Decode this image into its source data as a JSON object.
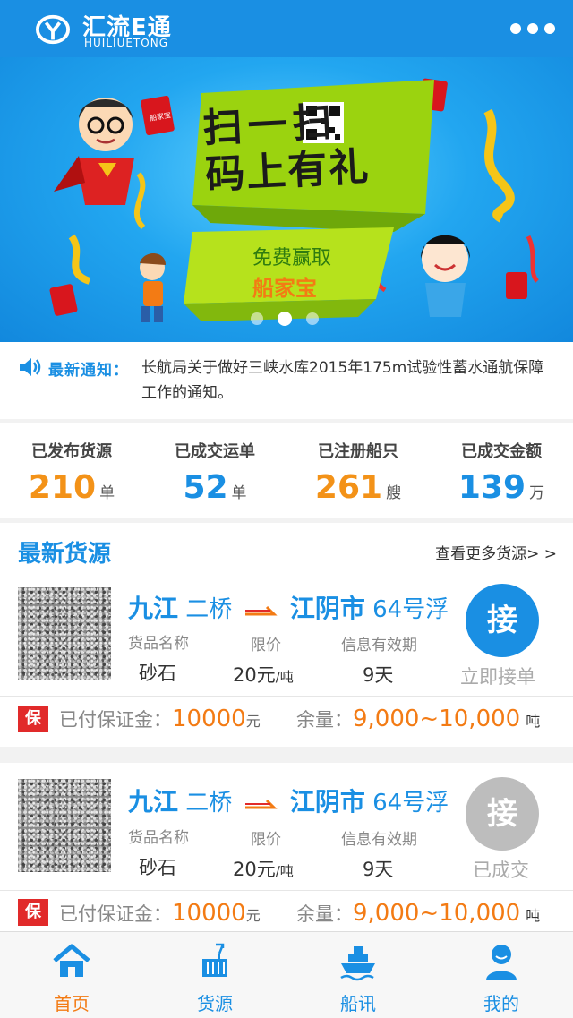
{
  "header": {
    "brand": "汇流E通",
    "brand_sub": "HUILIUETONG"
  },
  "banner": {
    "headline_1": "扫一扫",
    "headline_2": "码上有礼",
    "sub_1": "免费赢取",
    "sub_2": "船家宝",
    "badge": "船家宝",
    "slides": 3,
    "active_slide": 2
  },
  "notice": {
    "label": "最新通知：",
    "text": "长航局关于做好三峡水库2015年175m试验性蓄水通航保障工作的通知。"
  },
  "stats": [
    {
      "label": "已发布货源",
      "value": "210",
      "unit": "单",
      "color": "orange"
    },
    {
      "label": "已成交运单",
      "value": "52",
      "unit": "单",
      "color": "blue"
    },
    {
      "label": "已注册船只",
      "value": "261",
      "unit": "艘",
      "color": "orange"
    },
    {
      "label": "已成交金额",
      "value": "139",
      "unit": "万",
      "color": "blue"
    }
  ],
  "section": {
    "title": "最新货源",
    "more": "查看更多货源> >"
  },
  "cargo": [
    {
      "from": "九江",
      "from_detail": "二桥",
      "to": "江阴市",
      "to_detail": "64号浮",
      "head_name": "货品名称",
      "head_price": "限价",
      "head_valid": "信息有效期",
      "name": "砂石",
      "price": "20元",
      "price_unit": "/吨",
      "valid": "9天",
      "btn": "接",
      "btn_label": "立即接单",
      "btn_color": "#1a8fe3",
      "bao": "保",
      "deposit_label": "已付保证金：",
      "deposit": "10000",
      "deposit_unit": "元",
      "remain_label": "余量：",
      "remain": "9,000~10,000",
      "remain_unit": "吨"
    },
    {
      "from": "九江",
      "from_detail": "二桥",
      "to": "江阴市",
      "to_detail": "64号浮",
      "head_name": "货品名称",
      "head_price": "限价",
      "head_valid": "信息有效期",
      "name": "砂石",
      "price": "20元",
      "price_unit": "/吨",
      "valid": "9天",
      "btn": "接",
      "btn_label": "已成交",
      "btn_color": "#bdbdbd",
      "bao": "保",
      "deposit_label": "已付保证金：",
      "deposit": "10000",
      "deposit_unit": "元",
      "remain_label": "余量：",
      "remain": "9,000~10,000",
      "remain_unit": "吨"
    }
  ],
  "tabs": [
    {
      "label": "首页",
      "icon": "home-icon",
      "active": true
    },
    {
      "label": "货源",
      "icon": "cargo-icon",
      "active": false
    },
    {
      "label": "船讯",
      "icon": "ship-icon",
      "active": false
    },
    {
      "label": "我的",
      "icon": "user-icon",
      "active": false
    }
  ]
}
